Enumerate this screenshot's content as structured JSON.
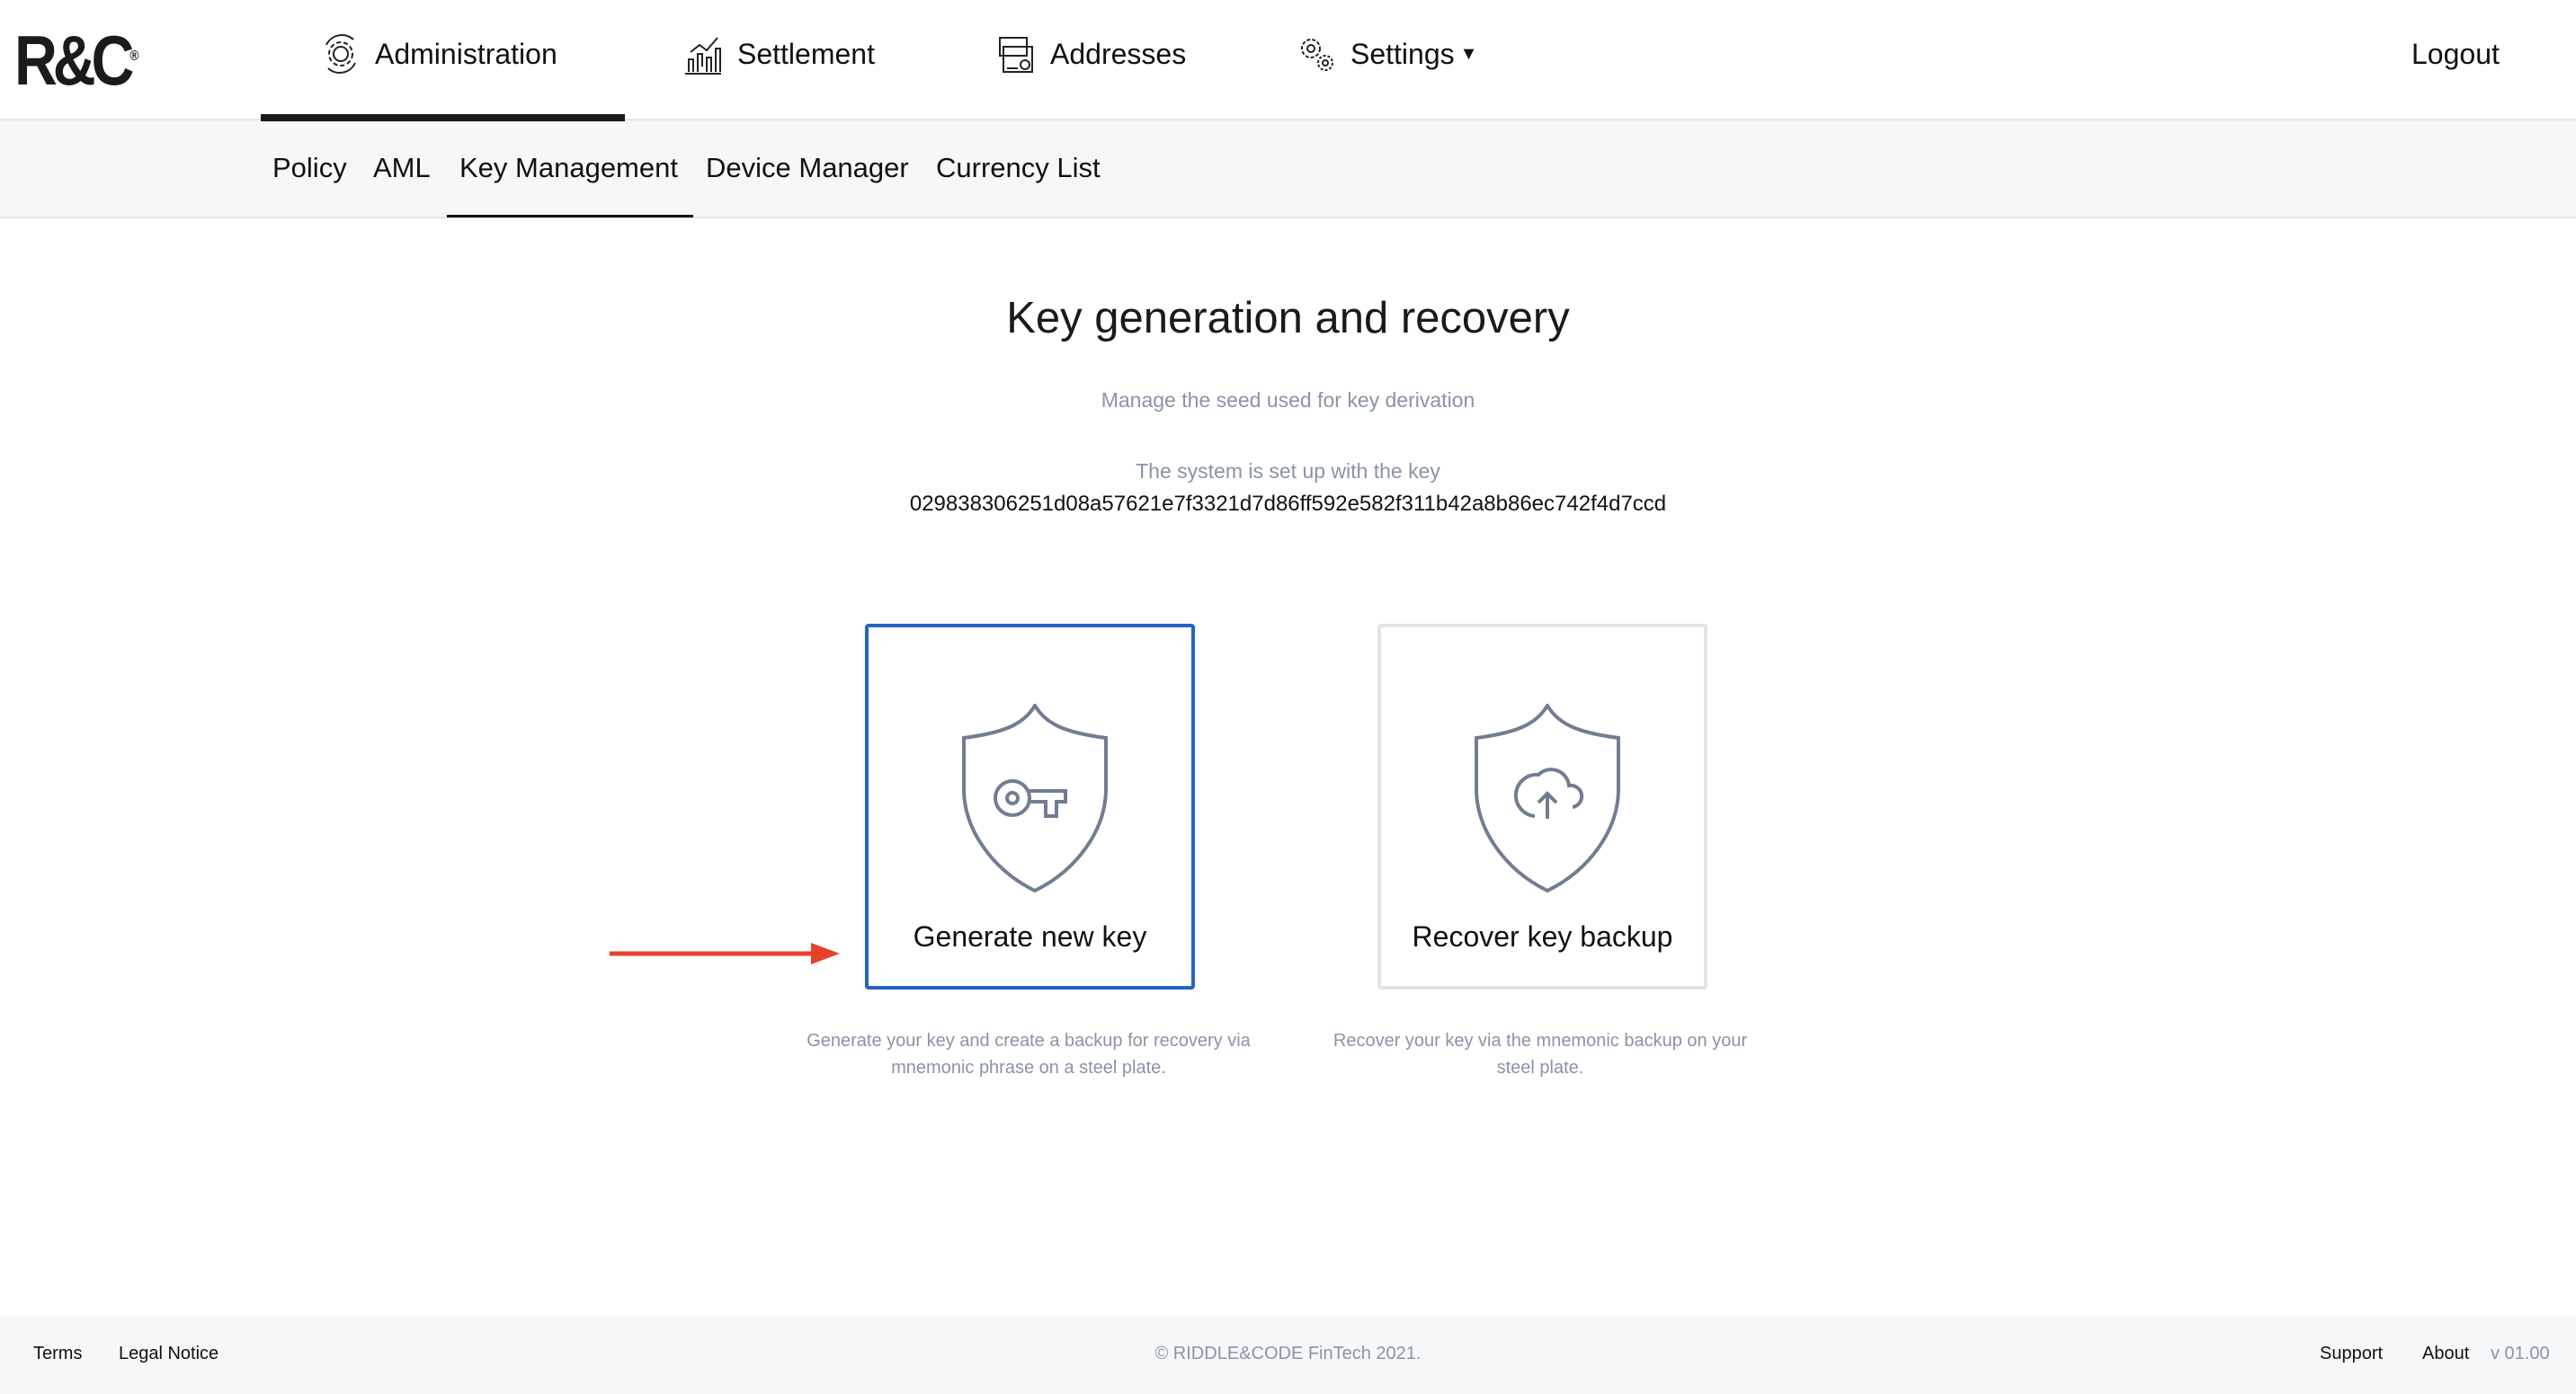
{
  "brand": {
    "logo": "R&C"
  },
  "topnav": {
    "items": [
      {
        "label": "Administration",
        "icon": "gear-cycle-icon",
        "active": true
      },
      {
        "label": "Settlement",
        "icon": "chart-bars-icon"
      },
      {
        "label": "Addresses",
        "icon": "address-cards-icon"
      },
      {
        "label": "Settings",
        "icon": "gears-icon",
        "dropdown": true
      }
    ],
    "logout": "Logout"
  },
  "subnav": {
    "items": [
      {
        "label": "Policy"
      },
      {
        "label": "AML"
      },
      {
        "label": "Key Management",
        "active": true
      },
      {
        "label": "Device Manager"
      },
      {
        "label": "Currency List"
      }
    ]
  },
  "main": {
    "title": "Key generation and recovery",
    "subtitle": "Manage the seed used for key derivation",
    "status_label": "The system is set up with the key",
    "key": "029838306251d08a57621e7f3321d7d86ff592e582f311b42a8b86ec742f4d7ccd",
    "cards": [
      {
        "title": "Generate new key",
        "icon": "shield-key-icon",
        "description": "Generate your key and create a backup for recovery via mnemonic phrase on a steel plate.",
        "selected": true
      },
      {
        "title": "Recover key backup",
        "icon": "shield-cloud-upload-icon",
        "description": "Recover your key via the mnemonic backup on your steel plate."
      }
    ]
  },
  "footer": {
    "terms": "Terms",
    "legal": "Legal Notice",
    "copyright": "© RIDDLE&CODE FinTech 2021.",
    "support": "Support",
    "about": "About",
    "version": "v 01.00"
  },
  "colors": {
    "accent": "#2563c9",
    "arrow": "#e8412c",
    "muted": "#8a93a6",
    "icon": "#727d92"
  }
}
